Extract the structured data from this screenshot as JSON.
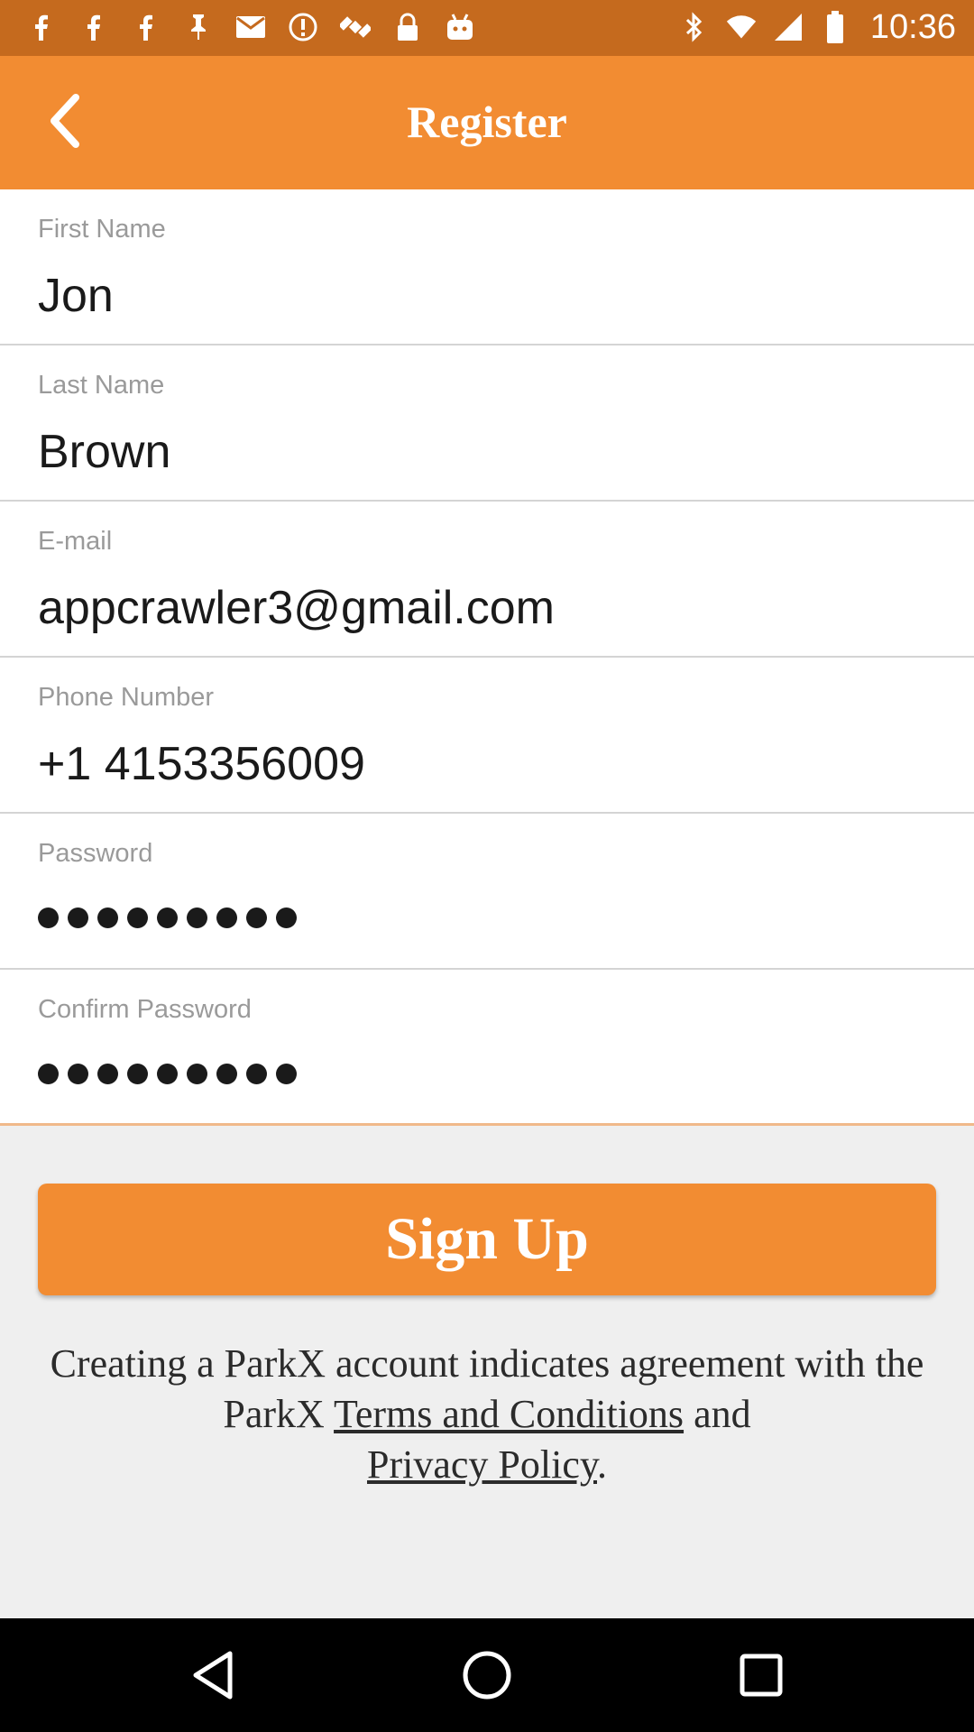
{
  "status_bar": {
    "time": "10:36",
    "left_icons": [
      "facebook-icon",
      "facebook-icon",
      "facebook-icon",
      "pin-icon",
      "mail-icon",
      "alert-icon",
      "satellite-icon",
      "lock-icon",
      "android-icon"
    ],
    "right_icons": [
      "bluetooth-icon",
      "wifi-icon",
      "signal-icon",
      "battery-icon"
    ]
  },
  "app_bar": {
    "title": "Register",
    "back_icon": "chevron-left-icon",
    "color": "#f28c32"
  },
  "form": {
    "first_name": {
      "label": "First Name",
      "value": "Jon"
    },
    "last_name": {
      "label": "Last Name",
      "value": "Brown"
    },
    "email": {
      "label": "E-mail",
      "value": "appcrawler3@gmail.com"
    },
    "phone": {
      "label": "Phone Number",
      "value": "+1 4153356009"
    },
    "password": {
      "label": "Password",
      "dot_count": 9
    },
    "confirm_password": {
      "label": "Confirm Password",
      "dot_count": 9
    }
  },
  "signup": {
    "label": "Sign Up",
    "color": "#f28c32"
  },
  "agreement": {
    "prefix": "Creating a ParkX account indicates agreement with the ParkX ",
    "terms_link": "Terms and Conditions",
    "middle": " and ",
    "privacy_link": "Privacy Policy",
    "suffix": "."
  },
  "nav_bar": {
    "icons": [
      "back-triangle-icon",
      "home-circle-icon",
      "recents-square-icon"
    ]
  }
}
